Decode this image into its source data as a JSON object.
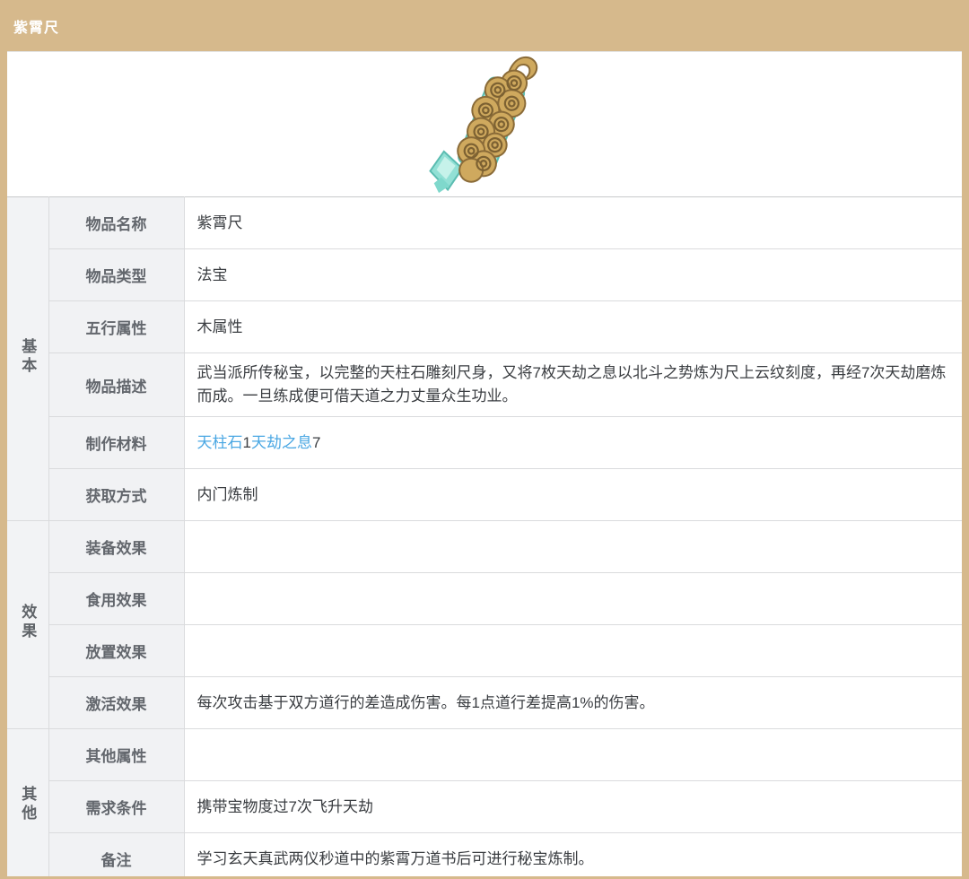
{
  "title": "紫霄尺",
  "theme": {
    "frame_color": "#d6b98c",
    "link_color": "#4aa7e3",
    "label_bg": "#f1f2f4",
    "label_text": "#63676d",
    "value_text": "#3a3d41"
  },
  "item_image": {
    "name": "紫霄尺",
    "icon": "cloud-ruler-icon",
    "gold": "#cfa95e",
    "gold_outline": "#8a6b38",
    "swirl": "#7c6132",
    "teal": "#9ce2d8",
    "teal_light": "#c6f2ea",
    "teal_dark": "#5bbcb1"
  },
  "groups": [
    {
      "label": "基本",
      "rows": [
        {
          "label": "物品名称",
          "value": "紫霄尺"
        },
        {
          "label": "物品类型",
          "value": "法宝"
        },
        {
          "label": "五行属性",
          "value": "木属性"
        },
        {
          "label": "物品描述",
          "value": "武当派所传秘宝，以完整的天柱石雕刻尺身，又将7枚天劫之息以北斗之势炼为尺上云纹刻度，再经7次天劫磨炼而成。一旦练成便可借天道之力丈量众生功业。"
        },
        {
          "label": "制作材料",
          "materials": [
            {
              "name": "天柱石",
              "count": "1"
            },
            {
              "name": "天劫之息",
              "count": "7"
            }
          ]
        },
        {
          "label": "获取方式",
          "value": "内门炼制"
        }
      ]
    },
    {
      "label": "效果",
      "rows": [
        {
          "label": "装备效果",
          "value": ""
        },
        {
          "label": "食用效果",
          "value": ""
        },
        {
          "label": "放置效果",
          "value": ""
        },
        {
          "label": "激活效果",
          "value": "每次攻击基于双方道行的差造成伤害。每1点道行差提高1%的伤害。"
        }
      ]
    },
    {
      "label": "其他",
      "rows": [
        {
          "label": "其他属性",
          "value": ""
        },
        {
          "label": "需求条件",
          "value": "携带宝物度过7次飞升天劫"
        },
        {
          "label": "备注",
          "value": "学习玄天真武两仪秒道中的紫霄万道书后可进行秘宝炼制。"
        }
      ]
    }
  ]
}
